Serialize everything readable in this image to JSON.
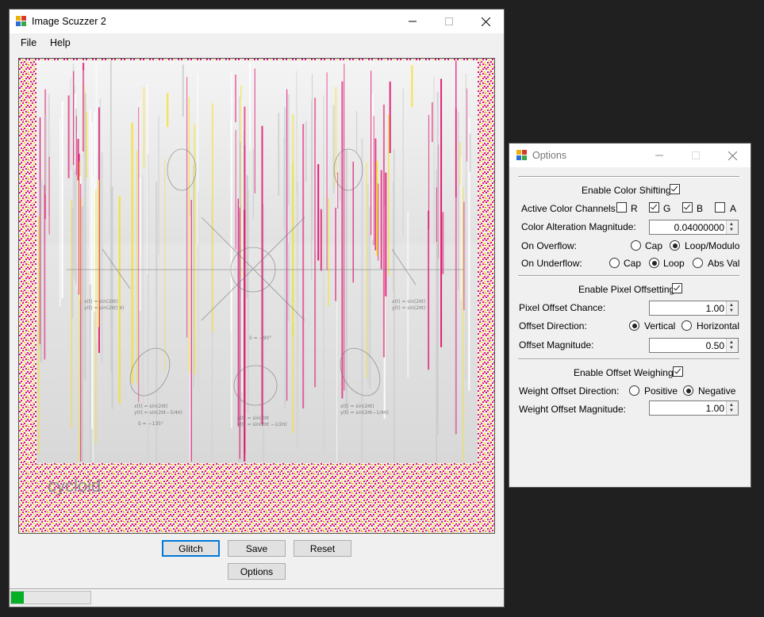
{
  "main_window": {
    "title": "Image Scuzzer 2",
    "menu": [
      "File",
      "Help"
    ],
    "image_caption": "cycloid",
    "buttons": {
      "glitch": "Glitch",
      "save": "Save",
      "reset": "Reset",
      "options": "Options"
    },
    "progress": 0.16,
    "progress_color": "#06b025"
  },
  "options_window": {
    "title": "Options",
    "color_shifting": {
      "enable_label": "Enable Color Shifting:",
      "enabled": true,
      "channels_label": "Active Color Channels:",
      "channels": [
        {
          "label": "R",
          "checked": false
        },
        {
          "label": "G",
          "checked": true
        },
        {
          "label": "B",
          "checked": true
        },
        {
          "label": "A",
          "checked": false
        }
      ],
      "magnitude_label": "Color Alteration Magnitude:",
      "magnitude_value": "0.04000000",
      "overflow_label": "On Overflow:",
      "overflow_options": [
        "Cap",
        "Loop/Modulo"
      ],
      "overflow_selected": "Loop/Modulo",
      "underflow_label": "On Underflow:",
      "underflow_options": [
        "Cap",
        "Loop",
        "Abs Val"
      ],
      "underflow_selected": "Loop"
    },
    "pixel_offsetting": {
      "enable_label": "Enable Pixel Offsetting:",
      "enabled": true,
      "chance_label": "Pixel Offset Chance:",
      "chance_value": "1.00",
      "direction_label": "Offset Direction:",
      "direction_options": [
        "Vertical",
        "Horizontal"
      ],
      "direction_selected": "Vertical",
      "magnitude_label": "Offset Magnitude:",
      "magnitude_value": "0.50"
    },
    "offset_weighing": {
      "enable_label": "Enable Offset Weighing:",
      "enabled": true,
      "direction_label": "Weight Offset Direction:",
      "direction_options": [
        "Positive",
        "Negative"
      ],
      "direction_selected": "Negative",
      "magnitude_label": "Weight Offset Magnitude:",
      "magnitude_value": "1.00"
    }
  },
  "colors": {
    "accent": "#0078d7",
    "noise_pink": "#e0106e",
    "noise_yellow": "#f5e12b",
    "progress": "#06b025"
  }
}
